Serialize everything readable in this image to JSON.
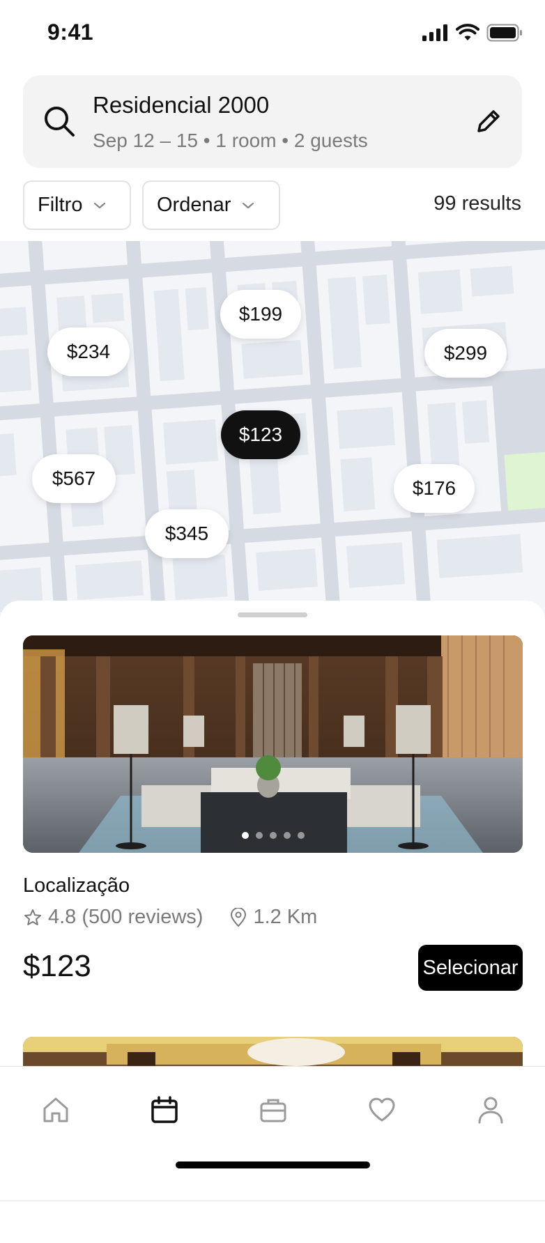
{
  "status_bar": {
    "time": "9:41"
  },
  "search": {
    "title": "Residencial 2000",
    "subtitle": "Sep 12 – 15 • 1 room • 2 guests"
  },
  "filters": {
    "filter_label": "Filtro",
    "sort_label": "Ordenar",
    "results_text": "99 results"
  },
  "map": {
    "pins": [
      {
        "label": "$199",
        "active": false
      },
      {
        "label": "$234",
        "active": false
      },
      {
        "label": "$299",
        "active": false
      },
      {
        "label": "$123",
        "active": true
      },
      {
        "label": "$567",
        "active": false
      },
      {
        "label": "$176",
        "active": false
      },
      {
        "label": "$345",
        "active": false
      }
    ]
  },
  "listing": {
    "name": "Localização",
    "rating": "4.8 (500 reviews)",
    "distance": "1.2 Km",
    "price": "$123",
    "select_label": "Selecionar",
    "photo_count": 5,
    "active_photo": 1
  },
  "tabbar": {
    "items": [
      {
        "icon": "home-icon",
        "active": false
      },
      {
        "icon": "calendar-icon",
        "active": true
      },
      {
        "icon": "briefcase-icon",
        "active": false
      },
      {
        "icon": "heart-icon",
        "active": false
      },
      {
        "icon": "profile-icon",
        "active": false
      }
    ]
  },
  "colors": {
    "accent": "#111111",
    "muted_text": "#7a7a7a",
    "map_road": "#d6dbe3",
    "map_block": "#f3f5f9",
    "map_park": "#dff5d2"
  }
}
